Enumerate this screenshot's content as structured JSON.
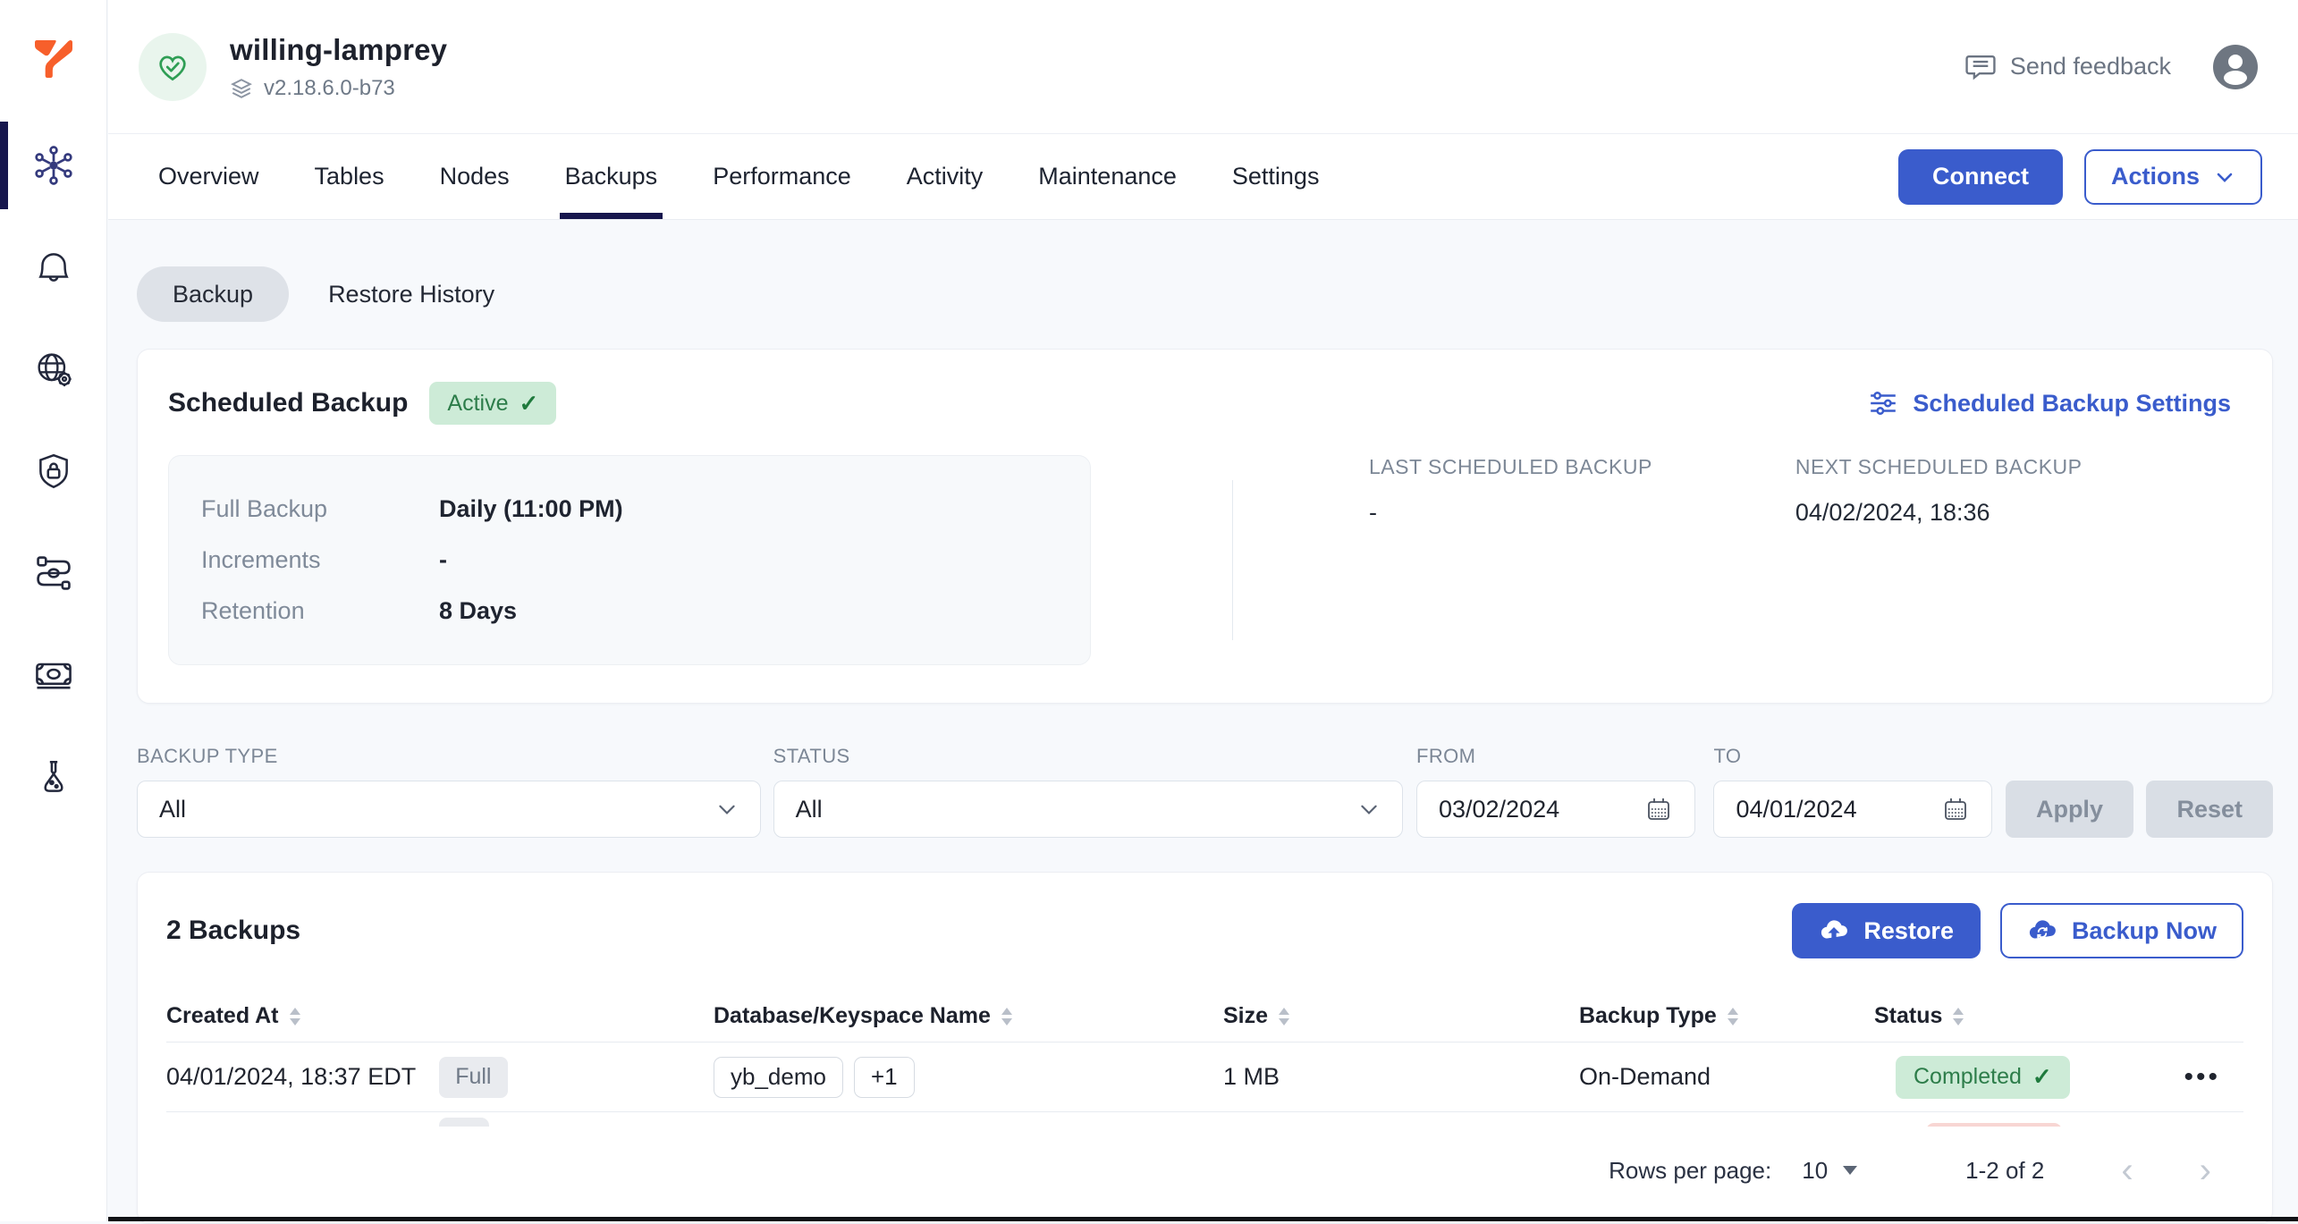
{
  "colors": {
    "accent_blue": "#3a5ccc",
    "dark_navy": "#16164d",
    "green_badge_bg": "#cdebd7",
    "green_badge_text": "#2d7d4a",
    "page_bg": "#f7f9fc",
    "logo_orange": "#f75f2b"
  },
  "icons": {
    "check": "✓",
    "ellipsis": "•••",
    "prev_arrow": "‹",
    "next_arrow": "›"
  },
  "header": {
    "cluster_name": "willing-lamprey",
    "version": "v2.18.6.0-b73",
    "send_feedback": "Send feedback"
  },
  "tabs": {
    "items": [
      "Overview",
      "Tables",
      "Nodes",
      "Backups",
      "Performance",
      "Activity",
      "Maintenance",
      "Settings"
    ],
    "active": "Backups",
    "connect_label": "Connect",
    "actions_label": "Actions"
  },
  "subtabs": {
    "backup": "Backup",
    "restore_history": "Restore History"
  },
  "scheduled_backup": {
    "title": "Scheduled Backup",
    "status_badge": "Active",
    "settings_link": "Scheduled Backup Settings",
    "details": [
      {
        "label": "Full Backup",
        "value": "Daily (11:00 PM)"
      },
      {
        "label": "Increments",
        "value": "-"
      },
      {
        "label": "Retention",
        "value": "8 Days"
      }
    ],
    "last_label": "LAST SCHEDULED BACKUP",
    "last_value": "-",
    "next_label": "NEXT SCHEDULED BACKUP",
    "next_value": "04/02/2024, 18:36"
  },
  "filters": {
    "backup_type": {
      "label": "BACKUP TYPE",
      "value": "All"
    },
    "status": {
      "label": "STATUS",
      "value": "All"
    },
    "from": {
      "label": "FROM",
      "value": "03/02/2024"
    },
    "to": {
      "label": "TO",
      "value": "04/01/2024"
    },
    "apply_label": "Apply",
    "reset_label": "Reset"
  },
  "backups": {
    "count_title": "2 Backups",
    "restore_label": "Restore",
    "backup_now_label": "Backup Now",
    "columns": [
      "Created At",
      "Database/Keyspace Name",
      "Size",
      "Backup Type",
      "Status"
    ],
    "rows": [
      {
        "created_at": "04/01/2024, 18:37 EDT",
        "type_badge": "Full",
        "keyspaces": [
          "yb_demo",
          "+1"
        ],
        "size": "1 MB",
        "backup_type": "On-Demand",
        "status": "Completed"
      }
    ],
    "pagination": {
      "rows_per_page_label": "Rows per page:",
      "rows_per_page": "10",
      "range": "1-2 of 2"
    }
  }
}
